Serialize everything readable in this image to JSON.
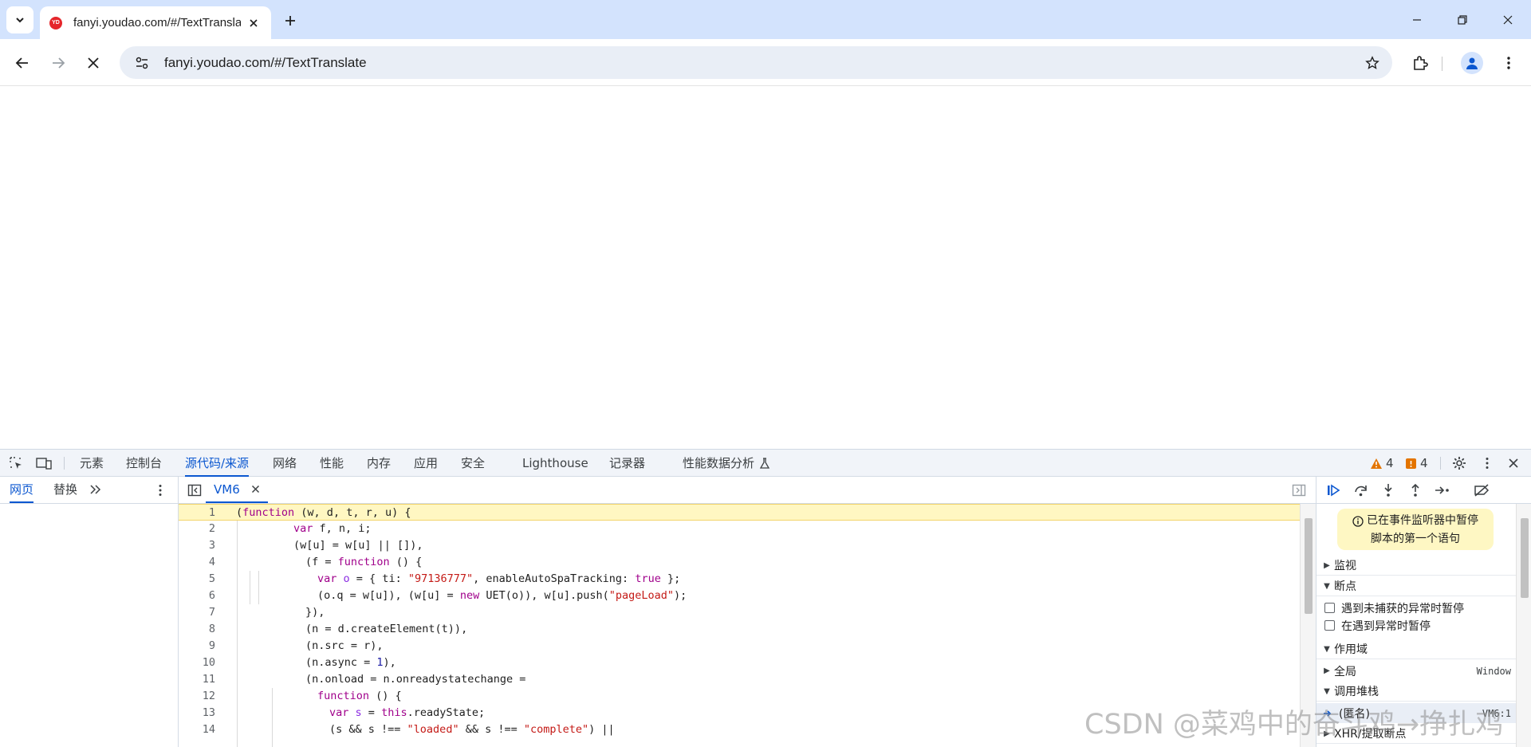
{
  "browser": {
    "tab": {
      "title": "fanyi.youdao.com/#/TextTranslate",
      "favicon_text": "YD"
    },
    "url": "fanyi.youdao.com/#/TextTranslate"
  },
  "devtools": {
    "tabs": [
      "元素",
      "控制台",
      "源代码/来源",
      "网络",
      "性能",
      "内存",
      "应用",
      "安全",
      "Lighthouse",
      "记录器",
      "性能数据分析"
    ],
    "active_tab": "源代码/来源",
    "warnings_count": "4",
    "errors_count": "4",
    "navigator_tabs": [
      "网页",
      "替换"
    ],
    "file_tab": "VM6",
    "code_lines": [
      {
        "n": "1",
        "tokens": [
          [
            "(",
            ""
          ],
          [
            "function",
            "kw"
          ],
          [
            " (w, d, t, r, u) {",
            ""
          ]
        ]
      },
      {
        "n": "2",
        "tokens": [
          [
            "var",
            "kw"
          ],
          [
            " f, n, i;",
            ""
          ]
        ]
      },
      {
        "n": "3",
        "tokens": [
          [
            "(w[u] = w[u] || []),",
            ""
          ]
        ]
      },
      {
        "n": "4",
        "tokens": [
          [
            "(f = ",
            ""
          ],
          [
            "function",
            "kw"
          ],
          [
            " () {",
            ""
          ]
        ]
      },
      {
        "n": "5",
        "tokens": [
          [
            "var",
            "kw"
          ],
          [
            " ",
            ""
          ],
          [
            "o",
            "var"
          ],
          [
            " = { ti: ",
            ""
          ],
          [
            "\"97136777\"",
            "str"
          ],
          [
            ", enableAutoSpaTracking: ",
            ""
          ],
          [
            "true",
            "lit"
          ],
          [
            " };",
            ""
          ]
        ]
      },
      {
        "n": "6",
        "tokens": [
          [
            "(o.q = w[u]), (w[u] = ",
            ""
          ],
          [
            "new",
            "kw"
          ],
          [
            " UET(o)), w[u].push(",
            ""
          ],
          [
            "\"pageLoad\"",
            "str"
          ],
          [
            ");",
            ""
          ]
        ]
      },
      {
        "n": "7",
        "tokens": [
          [
            "}),",
            ""
          ]
        ]
      },
      {
        "n": "8",
        "tokens": [
          [
            "(n = d.createElement(t)),",
            ""
          ]
        ]
      },
      {
        "n": "9",
        "tokens": [
          [
            "(n.src = r),",
            ""
          ]
        ]
      },
      {
        "n": "10",
        "tokens": [
          [
            "(n.async = ",
            ""
          ],
          [
            "1",
            "num"
          ],
          [
            "),",
            ""
          ]
        ]
      },
      {
        "n": "11",
        "tokens": [
          [
            "(n.onload = n.onreadystatechange =",
            ""
          ]
        ]
      },
      {
        "n": "12",
        "tokens": [
          [
            "function",
            "kw"
          ],
          [
            " () {",
            ""
          ]
        ]
      },
      {
        "n": "13",
        "tokens": [
          [
            "var",
            "kw"
          ],
          [
            " ",
            ""
          ],
          [
            "s",
            "var"
          ],
          [
            " = ",
            ""
          ],
          [
            "this",
            "kw"
          ],
          [
            ".readyState;",
            ""
          ]
        ]
      },
      {
        "n": "14",
        "tokens": [
          [
            "(s && s !== ",
            ""
          ],
          [
            "\"loaded\"",
            "str"
          ],
          [
            " && s !== ",
            ""
          ],
          [
            "\"complete\"",
            "str"
          ],
          [
            ") ||",
            ""
          ]
        ]
      }
    ],
    "debugger": {
      "paused_line1": "已在事件监听器中暂停",
      "paused_line2": "脚本的第一个语句",
      "watch": "监视",
      "breakpoints": "断点",
      "pause_uncaught": "遇到未捕获的异常时暂停",
      "pause_caught": "在遇到异常时暂停",
      "scope": "作用域",
      "global": "全局",
      "global_value": "Window",
      "call_stack": "调用堆栈",
      "frame_name": "(匿名)",
      "frame_loc": "VM6:1",
      "xhr_breakpoints": "XHR/提取断点"
    }
  },
  "watermark": "CSDN @菜鸡中的奋斗鸡→挣扎鸡"
}
